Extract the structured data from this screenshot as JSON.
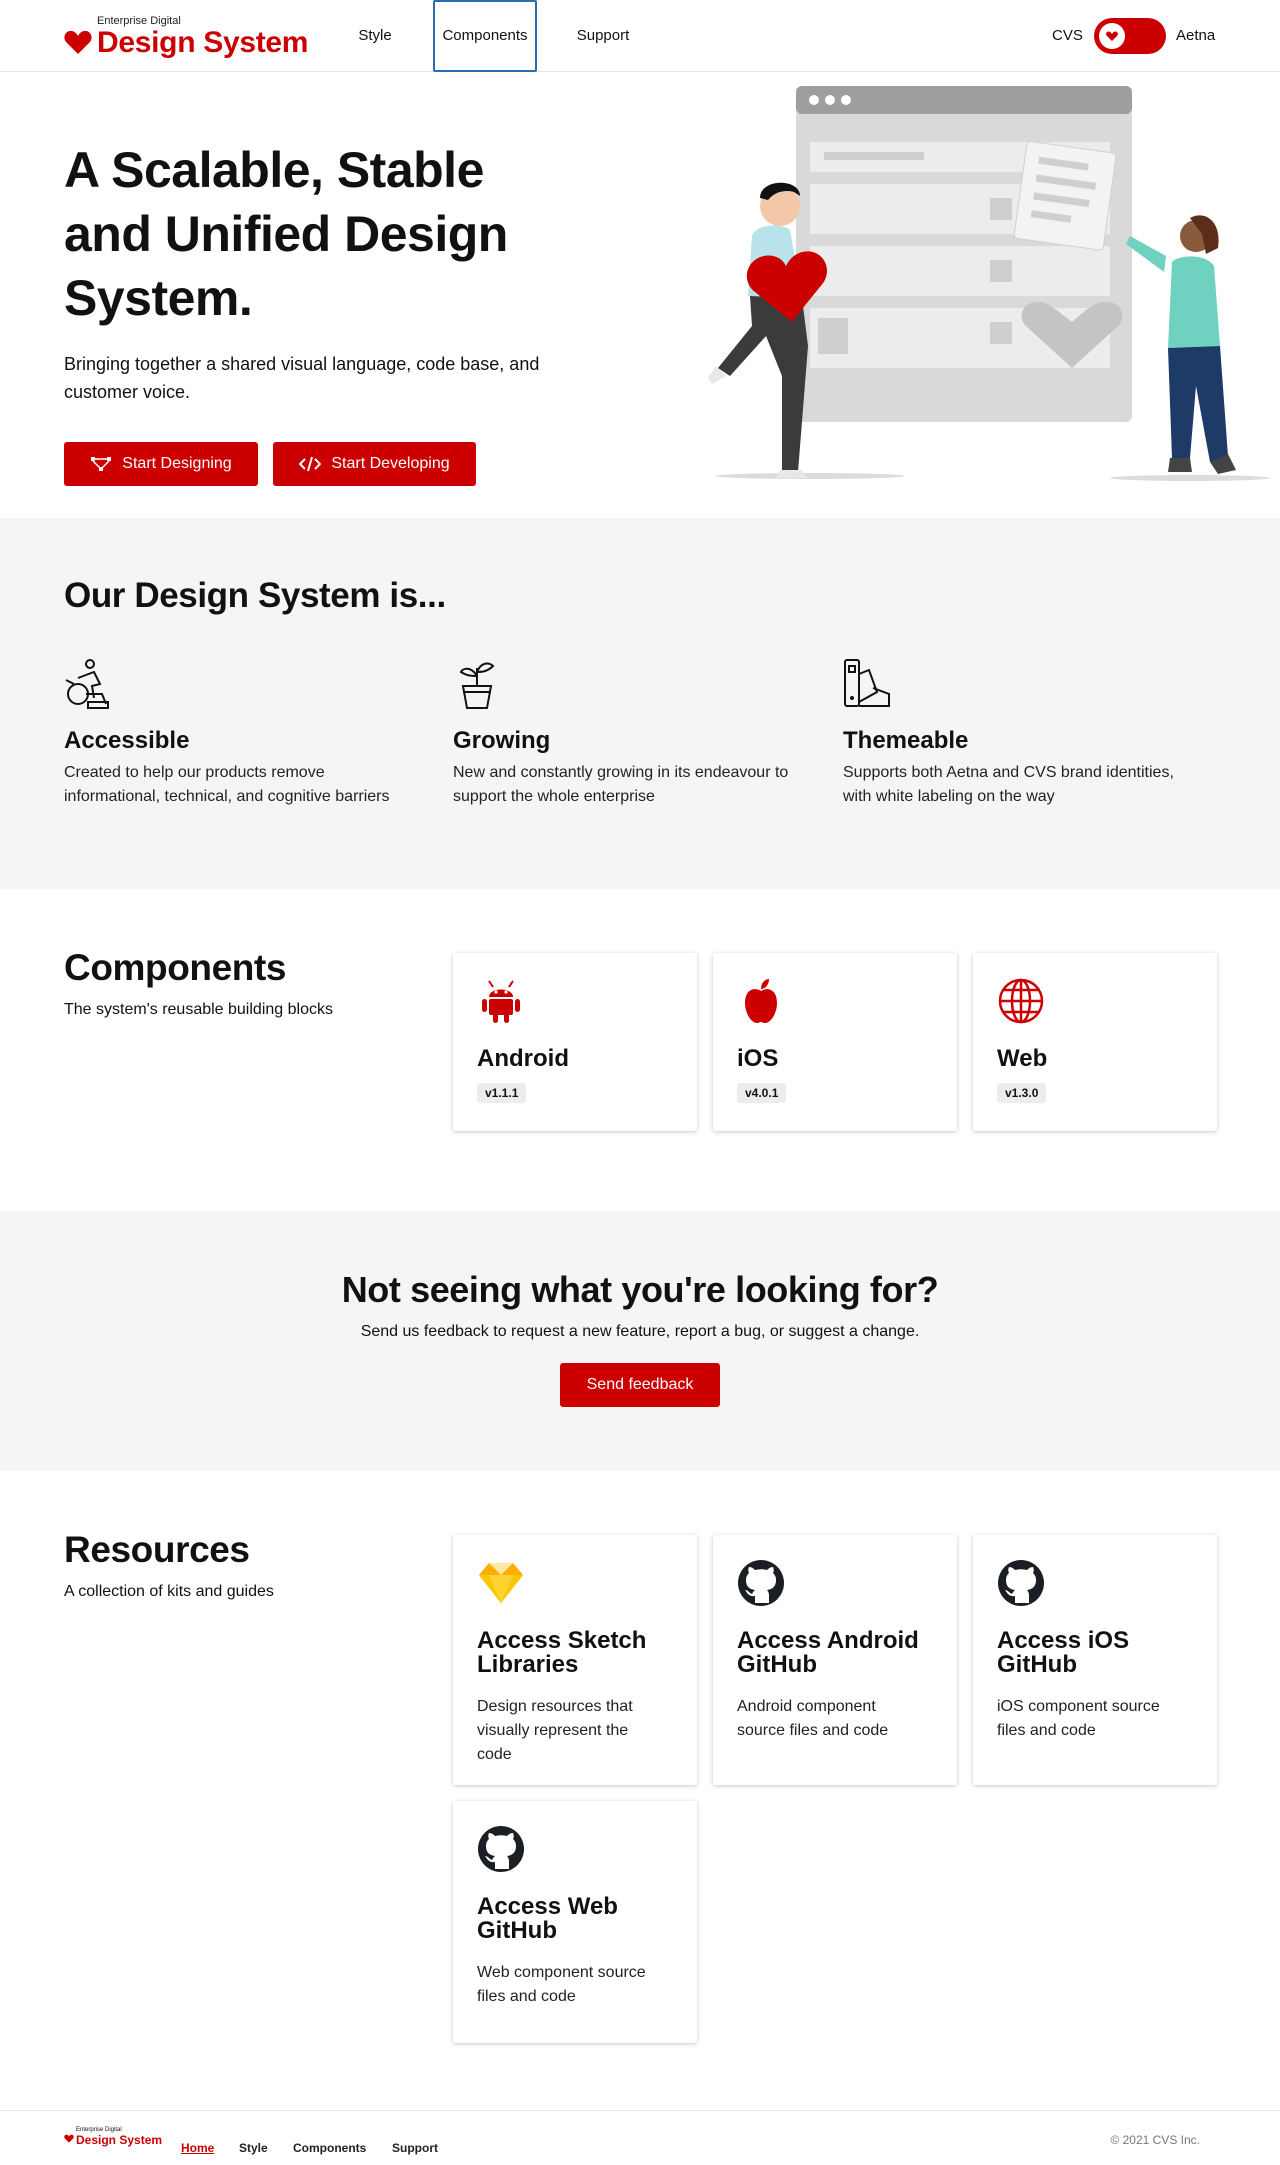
{
  "header": {
    "logo_small": "Enterprise Digital",
    "logo_big": "Design System",
    "nav": [
      "Style",
      "Components",
      "Support"
    ],
    "brand_left": "CVS",
    "brand_right": "Aetna"
  },
  "hero": {
    "title": "A Scalable, Stable and Unified Design System.",
    "subtitle": "Bringing together a shared visual language, code base, and customer voice.",
    "btn_design": "Start Designing",
    "btn_develop": "Start Developing"
  },
  "design_system": {
    "title": "Our Design System is...",
    "features": [
      {
        "icon": "accessibility-icon",
        "title": "Accessible",
        "desc": "Created to help our products remove informational, technical, and cognitive barriers"
      },
      {
        "icon": "plant-icon",
        "title": "Growing",
        "desc": "New and constantly growing in its endeavour to support the whole enterprise"
      },
      {
        "icon": "swatch-icon",
        "title": "Themeable",
        "desc": "Supports both Aetna and CVS brand identities, with white labeling on the way"
      }
    ]
  },
  "components": {
    "title": "Components",
    "subtitle": "The system's reusable building blocks",
    "cards": [
      {
        "icon": "android-icon",
        "title": "Android",
        "version": "v1.1.1"
      },
      {
        "icon": "apple-icon",
        "title": "iOS",
        "version": "v4.0.1"
      },
      {
        "icon": "globe-icon",
        "title": "Web",
        "version": "v1.3.0"
      }
    ]
  },
  "feedback": {
    "title": "Not seeing what you're looking for?",
    "subtitle": "Send us feedback to request a new feature, report a bug, or suggest a change.",
    "button": "Send feedback"
  },
  "resources": {
    "title": "Resources",
    "subtitle": "A collection of kits and guides",
    "cards": [
      {
        "icon": "sketch-icon",
        "title": "Access Sketch Libraries",
        "desc": "Design resources that visually represent the code"
      },
      {
        "icon": "github-icon",
        "title": "Access Android GitHub",
        "desc": "Android component source files and code"
      },
      {
        "icon": "github-icon",
        "title": "Access iOS GitHub",
        "desc": "iOS component source files and code"
      },
      {
        "icon": "github-icon",
        "title": "Access Web GitHub",
        "desc": "Web component source files and code"
      }
    ]
  },
  "footer": {
    "logo_small": "Enterprise Digital",
    "logo_big": "Design System",
    "links": [
      "Home",
      "Style",
      "Components",
      "Support"
    ],
    "copyright": "© 2021 CVS Inc."
  },
  "colors": {
    "brand_red": "#cc0000",
    "section_gray": "#f5f5f7",
    "nav_focus": "#2c6cb0"
  }
}
